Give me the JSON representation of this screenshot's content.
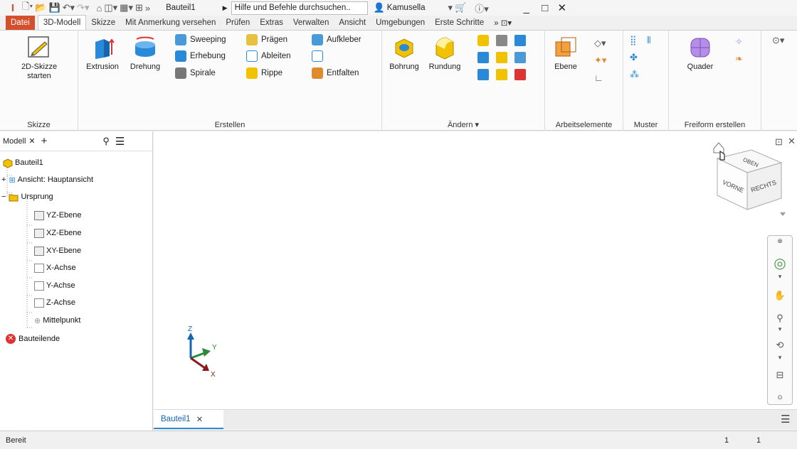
{
  "window": {
    "logo": "I",
    "doc_title": "Bauteil1",
    "search_placeholder": "Hilfe und Befehle durchsuchen..",
    "user": "Kamusella",
    "minimize": "_",
    "maximize": "□",
    "close": "✕"
  },
  "tabs": [
    "Datei",
    "3D-Modell",
    "Skizze",
    "Mit Anmerkung versehen",
    "Prüfen",
    "Extras",
    "Verwalten",
    "Ansicht",
    "Umgebungen",
    "Erste Schritte"
  ],
  "ribbon": {
    "skizze": {
      "label": "Skizze",
      "btn_line1": "2D-Skizze",
      "btn_line2": "starten"
    },
    "erstellen": {
      "label": "Erstellen",
      "extrusion": "Extrusion",
      "drehung": "Drehung",
      "sweeping": "Sweeping",
      "erhebung": "Erhebung",
      "spirale": "Spirale",
      "praegen": "Prägen",
      "ableiten": "Ableiten",
      "rippe": "Rippe",
      "aufkleber": "Aufkleber",
      "entfalten": "Entfalten"
    },
    "aendern": {
      "label": "Ändern",
      "bohrung": "Bohrung",
      "rundung": "Rundung"
    },
    "arbeitselemente": {
      "label": "Arbeitselemente",
      "ebene": "Ebene"
    },
    "muster": {
      "label": "Muster"
    },
    "freiform": {
      "label": "Freiform erstellen",
      "quader": "Quader"
    }
  },
  "browser": {
    "tab": "Modell",
    "add": "+",
    "tree": [
      "Bauteil1",
      "Ansicht: Hauptansicht",
      "Ursprung",
      "YZ-Ebene",
      "XZ-Ebene",
      "XY-Ebene",
      "X-Achse",
      "Y-Achse",
      "Z-Achse",
      "Mittelpunkt",
      "Bauteilende"
    ]
  },
  "viewcube": {
    "top": "OBEN",
    "front": "VORNE",
    "right": "RECHTS"
  },
  "triad": {
    "x": "X",
    "y": "Y",
    "z": "Z"
  },
  "doctab": {
    "label": "Bauteil1",
    "close": "✕"
  },
  "status": {
    "text": "Bereit",
    "n1": "1",
    "n2": "1"
  },
  "colors": {
    "file_tab": "#d4502c",
    "accent_blue": "#2b8ad8",
    "gold": "#f2c200"
  }
}
